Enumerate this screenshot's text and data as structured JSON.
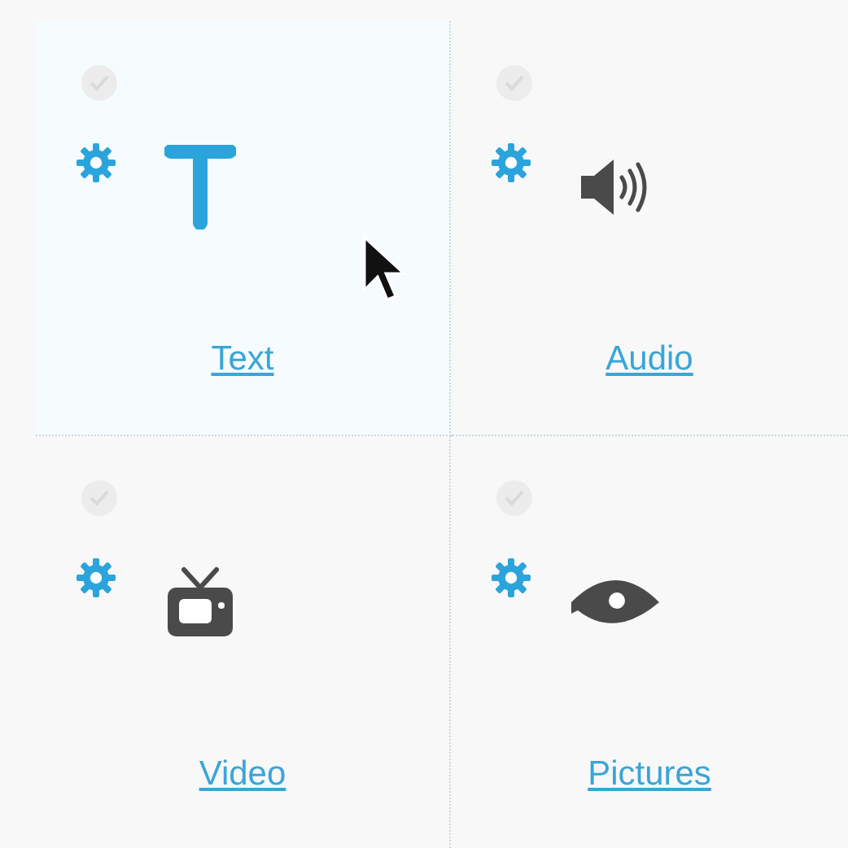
{
  "tiles": [
    {
      "kind": "text",
      "label": "Text",
      "selected": true,
      "checked": false
    },
    {
      "kind": "audio",
      "label": "Audio",
      "selected": false,
      "checked": false
    },
    {
      "kind": "video",
      "label": "Video",
      "selected": false,
      "checked": false
    },
    {
      "kind": "pictures",
      "label": "Pictures",
      "selected": false,
      "checked": false
    }
  ]
}
